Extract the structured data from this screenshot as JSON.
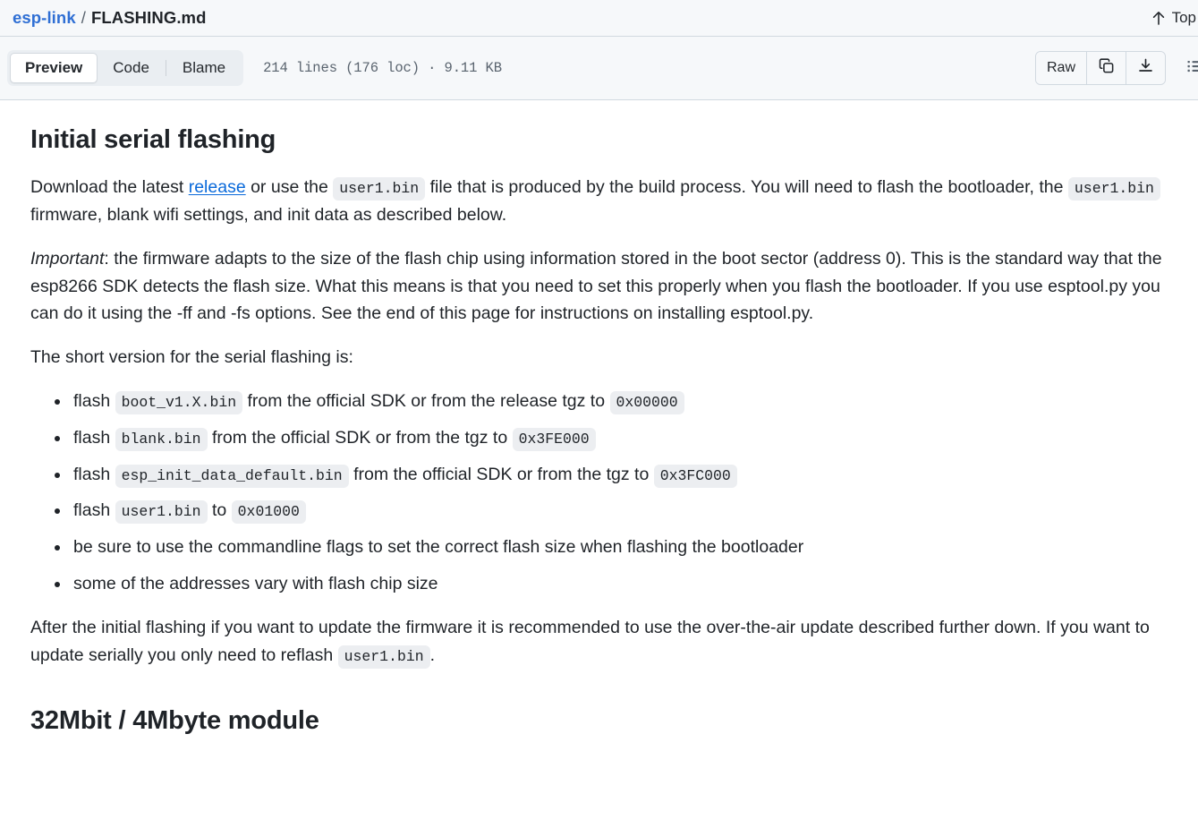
{
  "header": {
    "repo": "esp-link",
    "separator": "/",
    "filename": "FLASHING.md",
    "top_label": "Top",
    "top_icon": "arrow-up-icon"
  },
  "toolbar": {
    "tabs": [
      {
        "label": "Preview",
        "active": true
      },
      {
        "label": "Code",
        "active": false
      },
      {
        "label": "Blame",
        "active": false
      }
    ],
    "file_meta": "214 lines (176 loc) · 9.11 KB",
    "raw_label": "Raw",
    "copy_icon": "copy-icon",
    "download_icon": "download-icon",
    "outline_icon": "outline-list-icon"
  },
  "colors": {
    "link": "#0969da",
    "repo_link": "#2f6fd4",
    "header_bg": "#f6f8fa",
    "border": "#d1d9e0",
    "code_bg": "#eceef1",
    "text": "#1f2328",
    "muted": "#59636e"
  },
  "content": {
    "h1": "Initial serial flashing",
    "p1": {
      "a": "Download the latest ",
      "link": "release",
      "b": " or use the ",
      "code1": "user1.bin",
      "c": " file that is produced by the build process. You will need to flash the bootloader, the ",
      "code2": "user1.bin",
      "d": " firmware, blank wifi settings, and init data as described below."
    },
    "p2": {
      "em": "Important",
      "rest": ": the firmware adapts to the size of the flash chip using information stored in the boot sector (address 0). This is the standard way that the esp8266 SDK detects the flash size. What this means is that you need to set this properly when you flash the bootloader. If you use esptool.py you can do it using the -ff and -fs options. See the end of this page for instructions on installing esptool.py."
    },
    "p3": "The short version for the serial flashing is:",
    "bullets": [
      {
        "a": "flash ",
        "code1": "boot_v1.X.bin",
        "b": " from the official SDK or from the release tgz to ",
        "code2": "0x00000",
        "c": ""
      },
      {
        "a": "flash ",
        "code1": "blank.bin",
        "b": " from the official SDK or from the tgz to ",
        "code2": "0x3FE000",
        "c": ""
      },
      {
        "a": "flash ",
        "code1": "esp_init_data_default.bin",
        "b": " from the official SDK or from the tgz to ",
        "code2": "0x3FC000",
        "c": ""
      },
      {
        "a": "flash ",
        "code1": "user1.bin",
        "b": " to ",
        "code2": "0x01000",
        "c": ""
      },
      {
        "a": "be sure to use the commandline flags to set the correct flash size when flashing the bootloader",
        "code1": "",
        "b": "",
        "code2": "",
        "c": ""
      },
      {
        "a": "some of the addresses vary with flash chip size",
        "code1": "",
        "b": "",
        "code2": "",
        "c": ""
      }
    ],
    "p4": {
      "a": "After the initial flashing if you want to update the firmware it is recommended to use the over-the-air update described further down. If you want to update serially you only need to reflash ",
      "code1": "user1.bin",
      "b": "."
    },
    "h2": "32Mbit / 4Mbyte module"
  }
}
